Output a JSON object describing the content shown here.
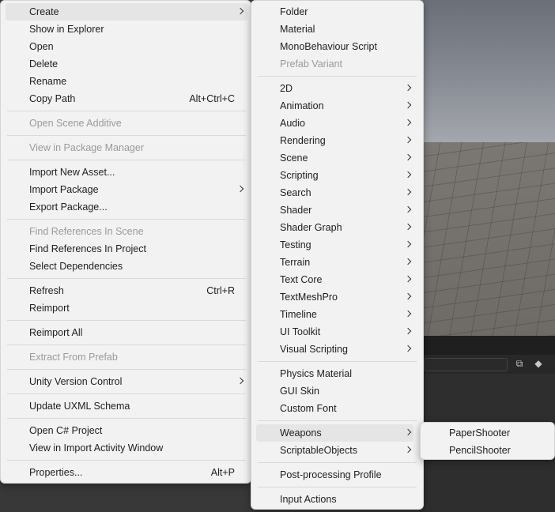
{
  "main_menu": {
    "items": [
      {
        "label": "Create",
        "submenu": true,
        "highlighted": true
      },
      {
        "label": "Show in Explorer"
      },
      {
        "label": "Open"
      },
      {
        "label": "Delete"
      },
      {
        "label": "Rename"
      },
      {
        "label": "Copy Path",
        "shortcut": "Alt+Ctrl+C"
      },
      {
        "label": "Open Scene Additive",
        "disabled": true
      },
      {
        "label": "View in Package Manager",
        "disabled": true
      },
      {
        "label": "Import New Asset..."
      },
      {
        "label": "Import Package",
        "submenu": true
      },
      {
        "label": "Export Package..."
      },
      {
        "label": "Find References In Scene",
        "disabled": true
      },
      {
        "label": "Find References In Project"
      },
      {
        "label": "Select Dependencies"
      },
      {
        "label": "Refresh",
        "shortcut": "Ctrl+R"
      },
      {
        "label": "Reimport"
      },
      {
        "label": "Reimport All"
      },
      {
        "label": "Extract From Prefab",
        "disabled": true
      },
      {
        "label": "Unity Version Control",
        "submenu": true
      },
      {
        "label": "Update UXML Schema"
      },
      {
        "label": "Open C# Project"
      },
      {
        "label": "View in Import Activity Window"
      },
      {
        "label": "Properties...",
        "shortcut": "Alt+P"
      }
    ]
  },
  "create_menu": {
    "items": [
      {
        "label": "Folder"
      },
      {
        "label": "Material"
      },
      {
        "label": "MonoBehaviour Script"
      },
      {
        "label": "Prefab Variant",
        "disabled": true
      },
      {
        "label": "2D",
        "submenu": true
      },
      {
        "label": "Animation",
        "submenu": true
      },
      {
        "label": "Audio",
        "submenu": true
      },
      {
        "label": "Rendering",
        "submenu": true
      },
      {
        "label": "Scene",
        "submenu": true
      },
      {
        "label": "Scripting",
        "submenu": true
      },
      {
        "label": "Search",
        "submenu": true
      },
      {
        "label": "Shader",
        "submenu": true
      },
      {
        "label": "Shader Graph",
        "submenu": true
      },
      {
        "label": "Testing",
        "submenu": true
      },
      {
        "label": "Terrain",
        "submenu": true
      },
      {
        "label": "Text Core",
        "submenu": true
      },
      {
        "label": "TextMeshPro",
        "submenu": true
      },
      {
        "label": "Timeline",
        "submenu": true
      },
      {
        "label": "UI Toolkit",
        "submenu": true
      },
      {
        "label": "Visual Scripting",
        "submenu": true
      },
      {
        "label": "Physics Material"
      },
      {
        "label": "GUI Skin"
      },
      {
        "label": "Custom Font"
      },
      {
        "label": "Weapons",
        "submenu": true,
        "highlighted": true
      },
      {
        "label": "ScriptableObjects",
        "submenu": true
      },
      {
        "label": "Post-processing Profile"
      },
      {
        "label": "Input Actions"
      }
    ]
  },
  "weapons_menu": {
    "items": [
      {
        "label": "PaperShooter"
      },
      {
        "label": "PencilShooter"
      }
    ]
  },
  "colors": {
    "menu_bg": "#f2f2f2",
    "highlight": "#e5e5e5",
    "disabled_text": "#9a9a9a",
    "text": "#1e1e1e"
  }
}
